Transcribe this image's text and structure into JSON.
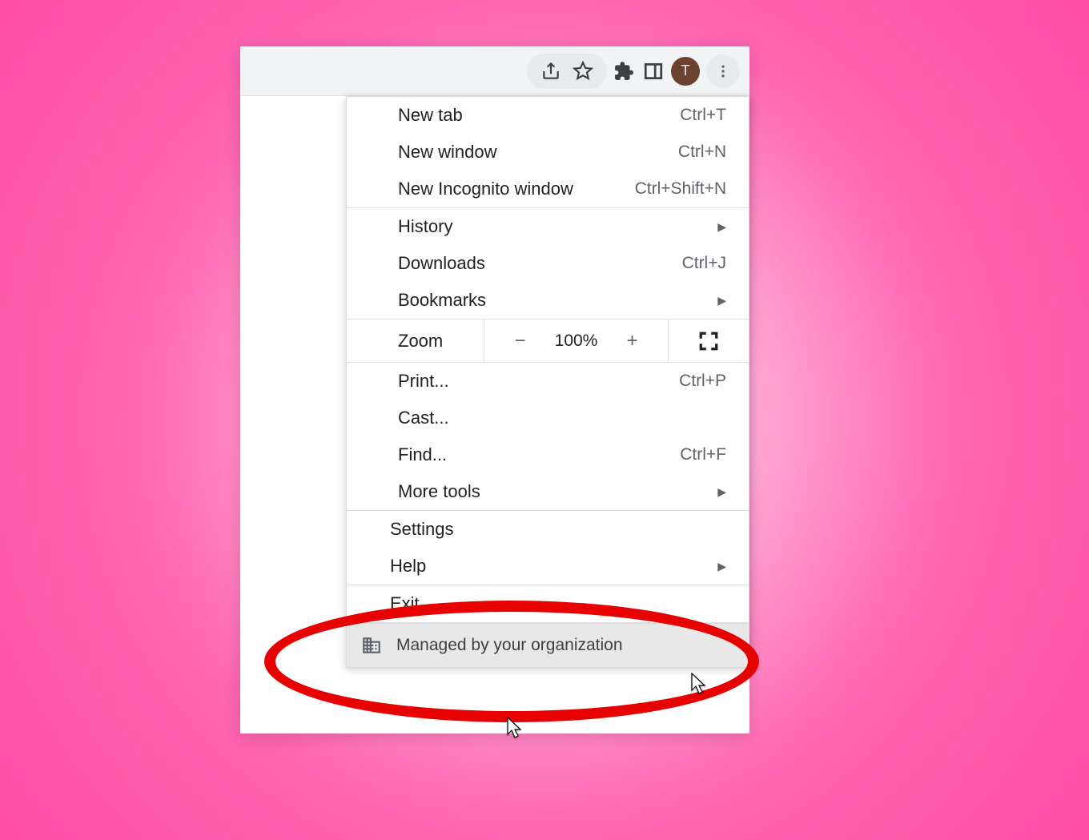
{
  "toolbar": {
    "avatar_letter": "T"
  },
  "menu": {
    "group1": [
      {
        "label": "New tab",
        "shortcut": "Ctrl+T"
      },
      {
        "label": "New window",
        "shortcut": "Ctrl+N"
      },
      {
        "label": "New Incognito window",
        "shortcut": "Ctrl+Shift+N"
      }
    ],
    "group2": [
      {
        "label": "History",
        "submenu": true
      },
      {
        "label": "Downloads",
        "shortcut": "Ctrl+J"
      },
      {
        "label": "Bookmarks",
        "submenu": true
      }
    ],
    "zoom": {
      "label": "Zoom",
      "value": "100%",
      "minus": "−",
      "plus": "+"
    },
    "group3": [
      {
        "label": "Print...",
        "shortcut": "Ctrl+P"
      },
      {
        "label": "Cast..."
      },
      {
        "label": "Find...",
        "shortcut": "Ctrl+F"
      },
      {
        "label": "More tools",
        "submenu": true
      }
    ],
    "group4": [
      {
        "label": "Settings"
      },
      {
        "label": "Help",
        "submenu": true
      }
    ],
    "group5": [
      {
        "label": "Exit"
      }
    ],
    "managed": "Managed by your organization"
  }
}
